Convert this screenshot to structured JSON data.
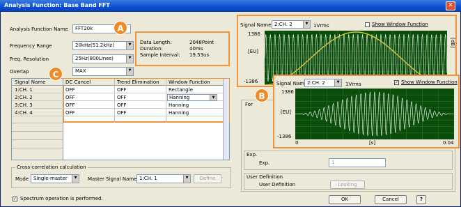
{
  "window": {
    "title": "Analysis Function: Base Band FFT",
    "close": "✕"
  },
  "form": {
    "analysis_function_name_label": "Analysis Function Name",
    "analysis_function_name_value": "FFT20k",
    "frequency_range_label": "Frequency Range",
    "frequency_range_value": "20kHz(51.2kHz)",
    "freq_resolution_label": "Freq. Resolution",
    "freq_resolution_value": "25Hz(800Lines)",
    "overlap_label": "Overlap",
    "overlap_value": "MAX"
  },
  "info": {
    "data_length_label": "Data Length:",
    "data_length_value": "2048Point",
    "duration_label": "Duration:",
    "duration_value": "40ms",
    "sample_interval_label": "Sample Interval:",
    "sample_interval_value": "19.53us"
  },
  "table": {
    "headers": [
      "Signal Name",
      "DC Cancel",
      "Trend Elimination",
      "Window Function"
    ],
    "rows": [
      [
        "1:CH. 1",
        "OFF",
        "OFF",
        "Rectangle"
      ],
      [
        "2:CH. 2",
        "OFF",
        "OFF",
        "Hanning"
      ],
      [
        "3:CH. 3",
        "OFF",
        "OFF",
        "Hanning"
      ],
      [
        "4:CH. 4",
        "OFF",
        "OFF",
        "Hanning"
      ]
    ]
  },
  "crosscorr": {
    "group_label": "Cross-correlation calculation",
    "mode_label": "Mode",
    "mode_value": "Single-master",
    "master_label": "Master Signal Name",
    "master_value": "1:CH. 1",
    "define_button": "Define"
  },
  "spectrum_check": {
    "label": "Spectrum operation is performed.",
    "checked": true
  },
  "graph_a": {
    "signal_label": "Signal Name",
    "signal_value": "2:CH. 2",
    "unit": "1Vrms",
    "show_window_label": "Show Window Function",
    "show_window_checked": false,
    "ytop": "1386",
    "ymid": "[EU]",
    "ybot": "-1386",
    "side_label": "[dB]"
  },
  "graph_b": {
    "signal_label": "Signal Name",
    "signal_value": "2:CH. 2",
    "unit": "1Vrms",
    "show_window_label": "Show Window Function",
    "show_window_checked": true,
    "ytop": "1386",
    "ymid": "[EU]",
    "ybot": "-1386",
    "x0": "0",
    "xmid": "[s]",
    "xend": "0.04"
  },
  "right_lower": {
    "for_label": "For",
    "exp_group": "Exp.",
    "exp_label": "Exp.",
    "exp_value": "1",
    "user_def_group": "User Definition",
    "user_def_label": "User Definition",
    "user_def_button": "Looking"
  },
  "buttons": {
    "ok": "OK",
    "cancel": "Cancel",
    "help": "?"
  },
  "badges": {
    "a": "A",
    "b": "B",
    "c": "C"
  },
  "colors": {
    "accent": "#f0933a",
    "title_bar": "#0b4fcf",
    "graph_bg": "#0a4d0a",
    "envelope": "#d6c23a",
    "trace": "#ffffff"
  }
}
